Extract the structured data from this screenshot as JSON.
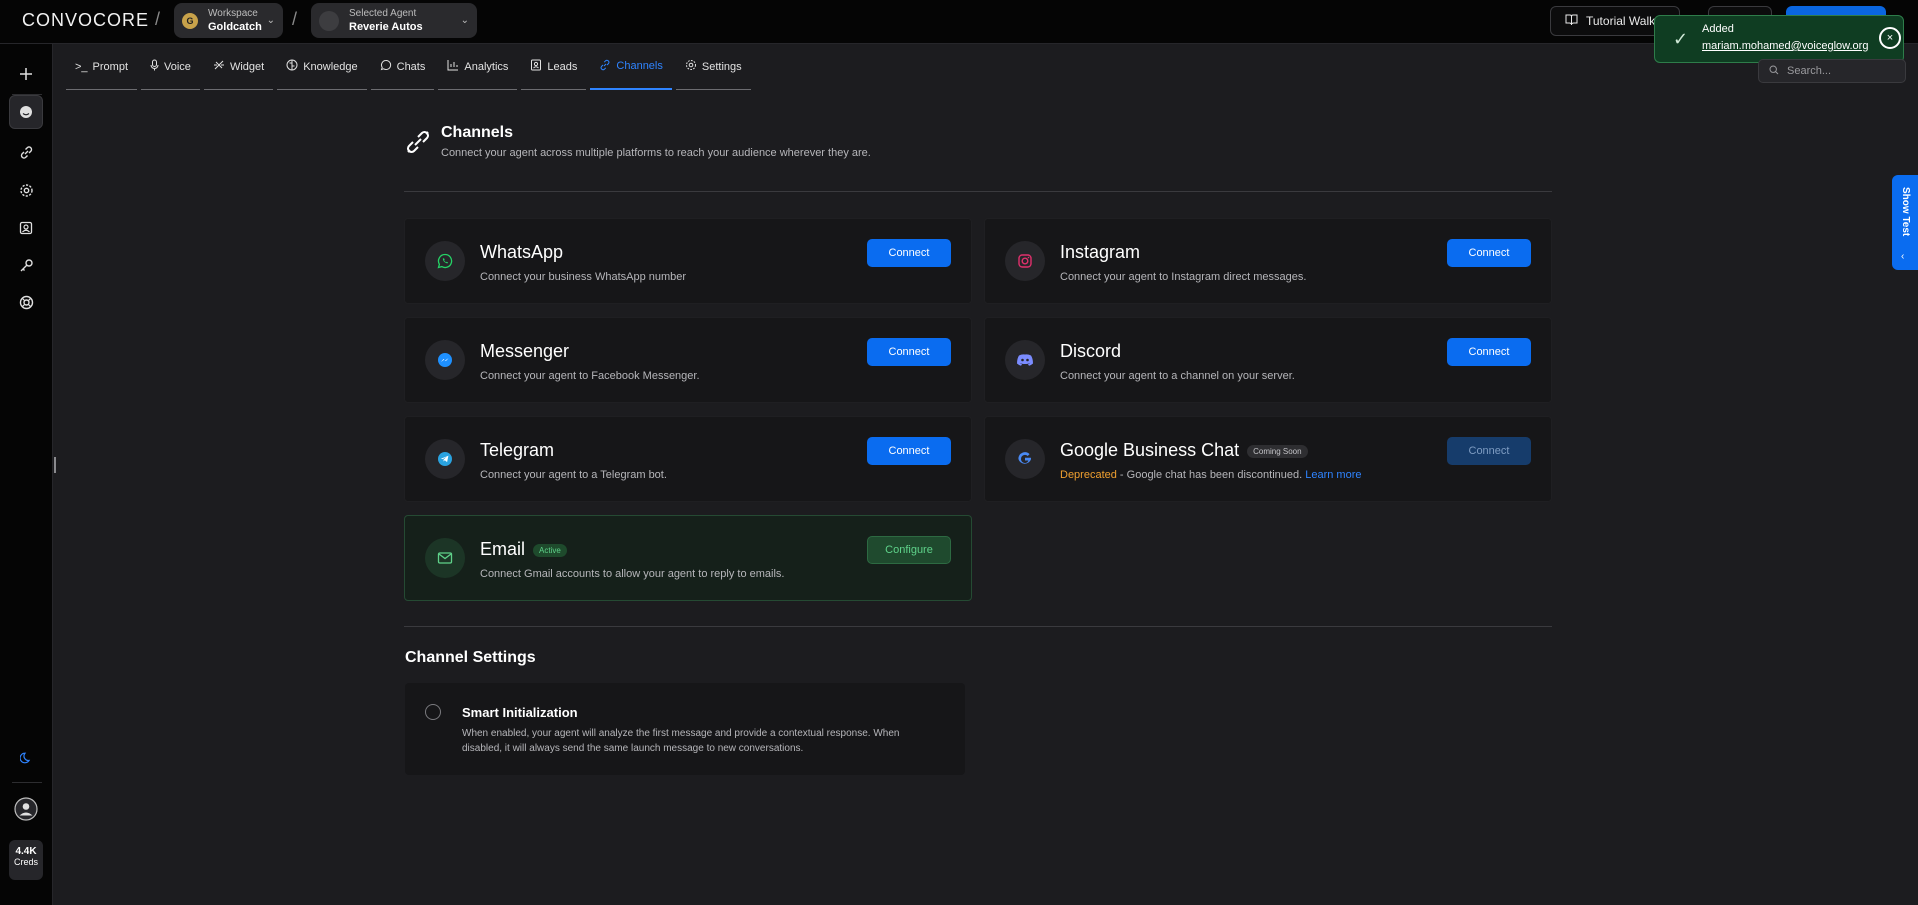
{
  "header": {
    "logo": "CONVOCORE",
    "workspace": {
      "label": "Workspace",
      "value": "Goldcatch",
      "avatar": "G"
    },
    "agent": {
      "label": "Selected Agent",
      "value": "Reverie Autos"
    },
    "tutorial_label": "Tutorial Walkth"
  },
  "toast": {
    "title": "Added",
    "message": "mariam.mohamed@voiceglow.org",
    "close": "×"
  },
  "tabs": [
    {
      "label": "Prompt",
      "icon": ">_"
    },
    {
      "label": "Voice",
      "icon": "🎙"
    },
    {
      "label": "Widget",
      "icon": "✎"
    },
    {
      "label": "Knowledge",
      "icon": "◍"
    },
    {
      "label": "Chats",
      "icon": "💬"
    },
    {
      "label": "Analytics",
      "icon": "📊"
    },
    {
      "label": "Leads",
      "icon": "👤"
    },
    {
      "label": "Channels",
      "icon": "🔗"
    },
    {
      "label": "Settings",
      "icon": "⚙"
    }
  ],
  "search": {
    "placeholder": "Search..."
  },
  "page": {
    "title": "Channels",
    "subtitle": "Connect your agent across multiple platforms to reach your audience wherever they are."
  },
  "channels": {
    "whatsapp": {
      "name": "WhatsApp",
      "desc": "Connect your business WhatsApp number",
      "button": "Connect",
      "color": "#25d366"
    },
    "instagram": {
      "name": "Instagram",
      "desc": "Connect your agent to Instagram direct messages.",
      "button": "Connect",
      "color": "#e1306c"
    },
    "messenger": {
      "name": "Messenger",
      "desc": "Connect your agent to Facebook Messenger.",
      "button": "Connect",
      "color": "#1e90ff"
    },
    "discord": {
      "name": "Discord",
      "desc": "Connect your agent to a channel on your server.",
      "button": "Connect",
      "color": "#7b8cff"
    },
    "telegram": {
      "name": "Telegram",
      "desc": "Connect your agent to a Telegram bot.",
      "button": "Connect",
      "color": "#2aa3e0"
    },
    "google": {
      "name": "Google Business Chat",
      "badge": "Coming Soon",
      "deprecated": "Deprecated",
      "desc": " - Google chat has been discontinued. ",
      "link": "Learn more",
      "button": "Connect"
    },
    "email": {
      "name": "Email",
      "badge": "Active",
      "desc": "Connect Gmail accounts to allow your agent to reply to emails.",
      "button": "Configure",
      "color": "#5fd28a"
    }
  },
  "channel_settings": {
    "title": "Channel Settings",
    "smart_init": {
      "title": "Smart Initialization",
      "desc": "When enabled, your agent will analyze the first message and provide a contextual response. When disabled, it will always send the same launch message to new conversations."
    }
  },
  "sidebar": {
    "credits_value": "4.4K",
    "credits_label": "Creds"
  },
  "show_test": {
    "label": "Show Test",
    "arrow": "‹"
  }
}
